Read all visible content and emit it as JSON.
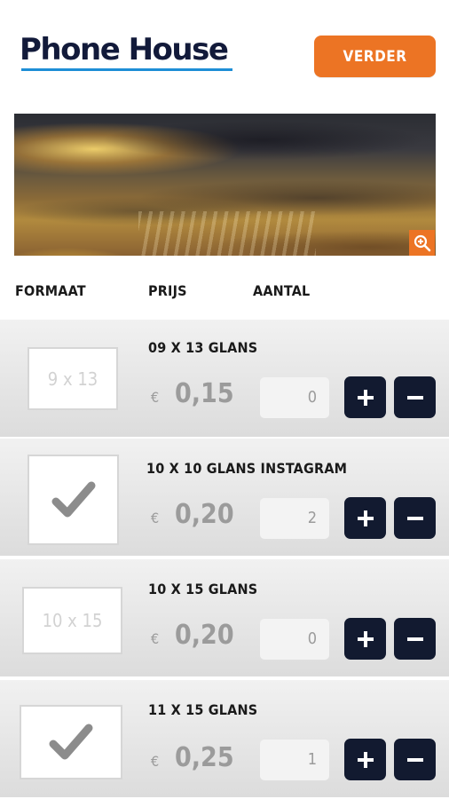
{
  "header": {
    "logo_text": "Phone House",
    "continue_label": "VERDER"
  },
  "photo": {
    "zoom_icon": "zoom-in-icon"
  },
  "columns": {
    "format": "FORMAAT",
    "price": "PRIJS",
    "quantity": "AANTAL"
  },
  "products": [
    {
      "thumb_label": "9 x 13",
      "selected": false,
      "name": "09 X 13 GLANS",
      "currency": "€",
      "price": "0,15",
      "quantity": "0",
      "plus_icon": "plus-icon",
      "minus_icon": "minus-icon"
    },
    {
      "thumb_label": "",
      "selected": true,
      "name": "10 X 10 GLANS INSTAGRAM",
      "currency": "€",
      "price": "0,20",
      "quantity": "2",
      "plus_icon": "plus-icon",
      "minus_icon": "minus-icon"
    },
    {
      "thumb_label": "10 x 15",
      "selected": false,
      "name": "10 X 15 GLANS",
      "currency": "€",
      "price": "0,20",
      "quantity": "0",
      "plus_icon": "plus-icon",
      "minus_icon": "minus-icon"
    },
    {
      "thumb_label": "",
      "selected": true,
      "name": "11 X 15 GLANS",
      "currency": "€",
      "price": "0,25",
      "quantity": "1",
      "plus_icon": "plus-icon",
      "minus_icon": "minus-icon"
    }
  ],
  "colors": {
    "accent": "#ec7424",
    "navy": "#121a30",
    "logo_underline": "#1d8ed6"
  }
}
